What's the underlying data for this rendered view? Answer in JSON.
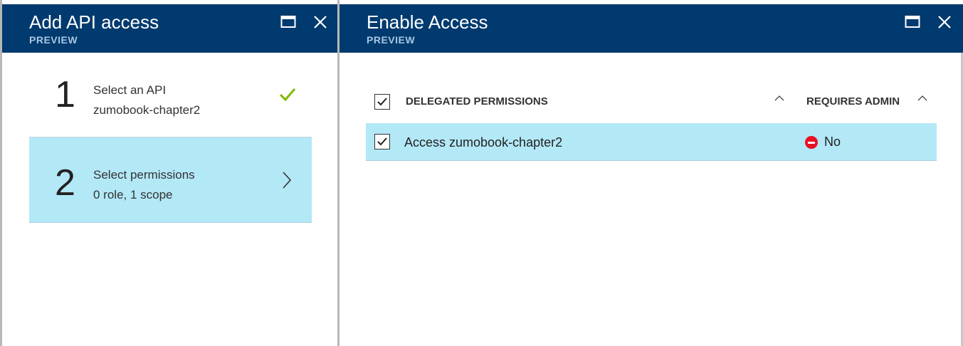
{
  "left_blade": {
    "title": "Add API access",
    "subtitle": "PREVIEW",
    "steps": [
      {
        "number": "1",
        "line1": "Select an API",
        "line2": "zumobook-chapter2",
        "status_icon": "checkmark-icon"
      },
      {
        "number": "2",
        "line1": "Select permissions",
        "line2": "0 role, 1 scope",
        "status_icon": "chevron-right-icon"
      }
    ]
  },
  "right_blade": {
    "title": "Enable Access",
    "subtitle": "PREVIEW",
    "columns": [
      "DELEGATED PERMISSIONS",
      "REQUIRES ADMIN"
    ],
    "rows": [
      {
        "permission": "Access zumobook-chapter2",
        "requires_admin": "No",
        "checked": true
      }
    ]
  },
  "colors": {
    "header_bg": "#003a6e",
    "subtitle": "#a9c6e4",
    "selection": "#b3e8f7",
    "check_green": "#7fba00",
    "no_red": "#e81123"
  }
}
